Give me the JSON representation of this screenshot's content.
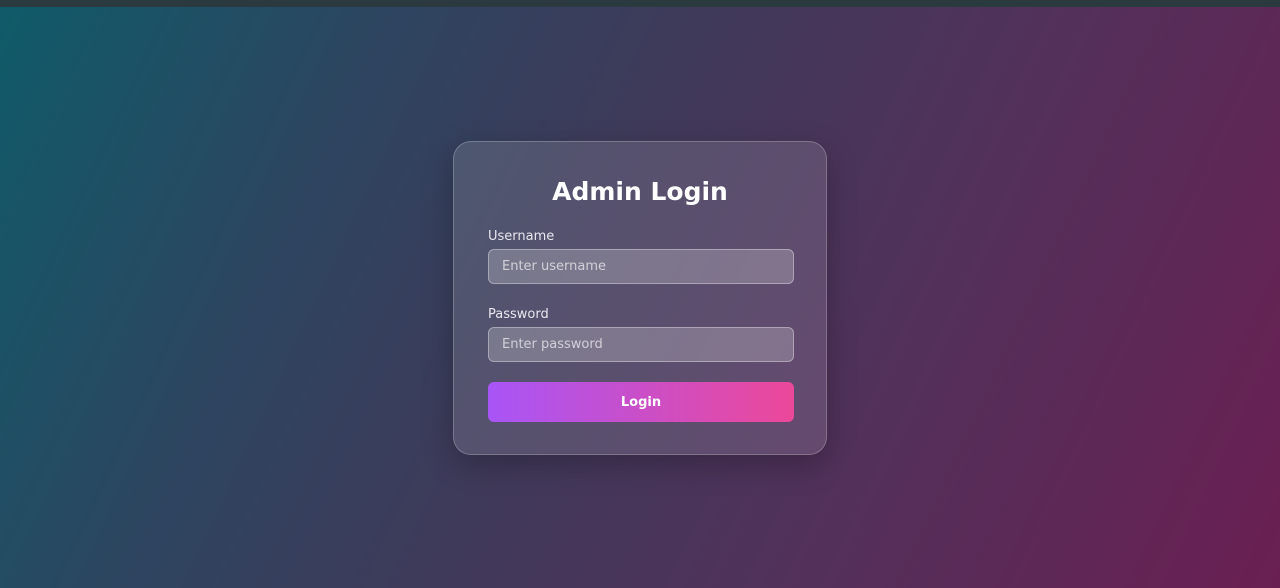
{
  "login": {
    "title": "Admin Login",
    "username_label": "Username",
    "username_placeholder": "Enter username",
    "password_label": "Password",
    "password_placeholder": "Enter password",
    "submit_label": "Login"
  },
  "colors": {
    "button_gradient_start": "#a855f7",
    "button_gradient_end": "#ec4899"
  }
}
